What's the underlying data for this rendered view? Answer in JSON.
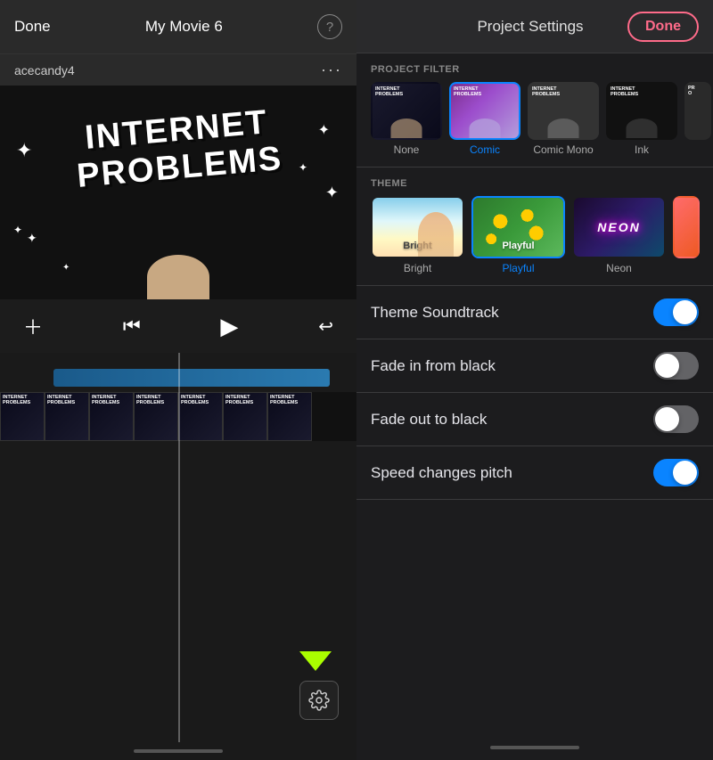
{
  "left": {
    "done_label": "Done",
    "title": "My Movie 6",
    "help": "?",
    "username": "acecandy4",
    "dots": "···",
    "video_text_line1": "INTERNET",
    "video_text_line2": "PROBLEMS",
    "controls": {
      "add": "+",
      "rewind": "⏮",
      "play": "▶",
      "undo": "↩"
    },
    "settings_label": "Settings",
    "arrow_hint": "↓"
  },
  "right": {
    "title": "Project Settings",
    "done_label": "Done",
    "filter_section": "PROJECT FILTER",
    "theme_section": "THEME",
    "filters": [
      {
        "id": "none",
        "label": "None",
        "selected": false
      },
      {
        "id": "comic",
        "label": "Comic",
        "selected": true
      },
      {
        "id": "comic-mono",
        "label": "Comic Mono",
        "selected": false
      },
      {
        "id": "ink",
        "label": "Ink",
        "selected": false
      },
      {
        "id": "next",
        "label": "…",
        "selected": false
      }
    ],
    "themes": [
      {
        "id": "bright",
        "label": "Bright",
        "selected": false
      },
      {
        "id": "playful",
        "label": "Playful",
        "selected": true
      },
      {
        "id": "neon",
        "label": "Neon",
        "selected": false
      }
    ],
    "settings": [
      {
        "id": "theme-soundtrack",
        "label": "Theme Soundtrack",
        "on": true
      },
      {
        "id": "fade-in",
        "label": "Fade in from black",
        "on": false
      },
      {
        "id": "fade-out",
        "label": "Fade out to black",
        "on": false
      },
      {
        "id": "speed-pitch",
        "label": "Speed changes pitch",
        "on": true
      }
    ]
  }
}
